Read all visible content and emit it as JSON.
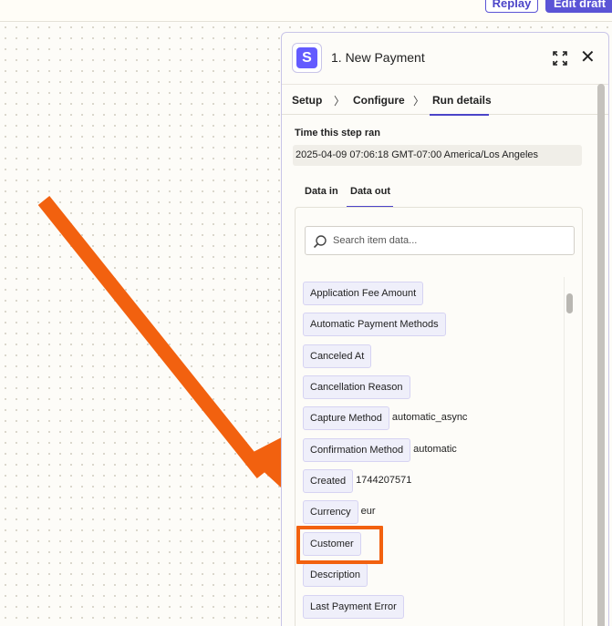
{
  "topbar": {
    "replay_label": "Replay",
    "edit_label": "Edit draft"
  },
  "panel": {
    "app_logo_letter": "S",
    "title": "1. New Payment",
    "tabs": [
      {
        "label": "Setup"
      },
      {
        "label": "Configure"
      },
      {
        "label": "Run details",
        "active": true
      }
    ],
    "time_label": "Time this step ran",
    "time_value": "2025-04-09 07:06:18 GMT-07:00 America/Los Angeles",
    "subtabs": [
      {
        "label": "Data in"
      },
      {
        "label": "Data out",
        "active": true
      }
    ],
    "search": {
      "placeholder": "Search item data..."
    },
    "items": [
      {
        "key": "Application Fee Amount",
        "value": ""
      },
      {
        "key": "Automatic Payment Methods",
        "value": ""
      },
      {
        "key": "Canceled At",
        "value": ""
      },
      {
        "key": "Cancellation Reason",
        "value": ""
      },
      {
        "key": "Capture Method",
        "value": "automatic_async"
      },
      {
        "key": "Confirmation Method",
        "value": "automatic"
      },
      {
        "key": "Created",
        "value": "1744207571"
      },
      {
        "key": "Currency",
        "value": "eur"
      },
      {
        "key": "Customer",
        "value": ""
      },
      {
        "key": "Description",
        "value": ""
      },
      {
        "key": "Last Payment Error",
        "value": ""
      }
    ]
  },
  "colors": {
    "accent": "#5b54d6",
    "annotation": "#f2610f",
    "app_brand": "#635bff"
  },
  "icons": {
    "expand": "expand-icon",
    "close": "close-icon",
    "search": "search-icon",
    "chevron": "chevron-right-icon"
  }
}
